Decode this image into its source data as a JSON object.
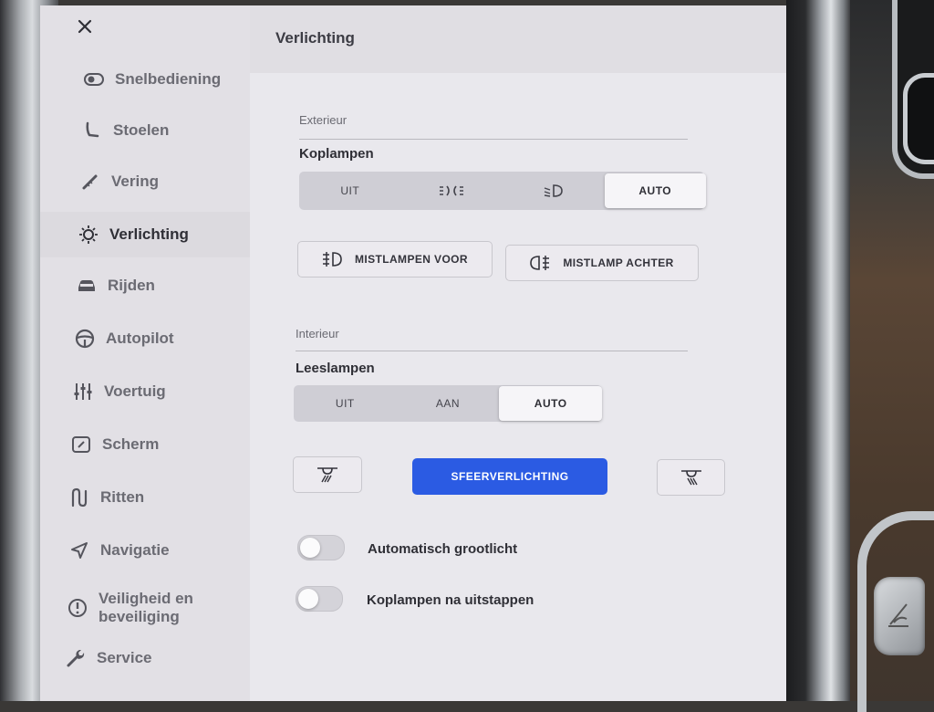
{
  "app": {
    "title": "Verlichting"
  },
  "sidebar": {
    "items": [
      {
        "label": "Snelbediening",
        "icon": "toggle-icon",
        "active": false
      },
      {
        "label": "Stoelen",
        "icon": "seat-icon",
        "active": false
      },
      {
        "label": "Vering",
        "icon": "suspension-icon",
        "active": false
      },
      {
        "label": "Verlichting",
        "icon": "light-bulb-icon",
        "active": true
      },
      {
        "label": "Rijden",
        "icon": "car-icon",
        "active": false
      },
      {
        "label": "Autopilot",
        "icon": "steering-wheel-icon",
        "active": false
      },
      {
        "label": "Voertuig",
        "icon": "sliders-icon",
        "active": false
      },
      {
        "label": "Scherm",
        "icon": "display-icon",
        "active": false
      },
      {
        "label": "Ritten",
        "icon": "trips-icon",
        "active": false
      },
      {
        "label": "Navigatie",
        "icon": "navigation-arrow-icon",
        "active": false
      },
      {
        "label": "Veiligheid en beveiliging",
        "label_line1": "Veiligheid en",
        "label_line2": "beveiliging",
        "icon": "alert-circle-icon",
        "active": false
      },
      {
        "label": "Service",
        "icon": "wrench-icon",
        "active": false
      }
    ]
  },
  "exterior": {
    "section_label": "Exterieur",
    "headlights": {
      "label": "Koplampen",
      "options": [
        {
          "label": "UIT",
          "icon": null
        },
        {
          "label": "",
          "icon": "parking-lights-icon"
        },
        {
          "label": "",
          "icon": "low-beam-icon"
        },
        {
          "label": "AUTO",
          "icon": null
        }
      ],
      "selected": "AUTO"
    },
    "fog_front": {
      "label": "MISTLAMPEN VOOR",
      "icon": "front-fog-icon"
    },
    "fog_rear": {
      "label": "MISTLAMP ACHTER",
      "icon": "rear-fog-icon"
    }
  },
  "interior": {
    "section_label": "Interieur",
    "reading_lights": {
      "label": "Leeslampen",
      "options": [
        "UIT",
        "AAN",
        "AUTO"
      ],
      "selected": "AUTO"
    },
    "ambient": {
      "label": "SFEERVERLICHTING",
      "left_icon": "dome-light-left-icon",
      "right_icon": "dome-light-right-icon"
    }
  },
  "toggles": [
    {
      "label": "Automatisch grootlicht",
      "on": false
    },
    {
      "label": "Koplampen na uitstappen",
      "on": false
    }
  ],
  "colors": {
    "accent": "#2b5be3",
    "background": "#e9e8ed"
  }
}
